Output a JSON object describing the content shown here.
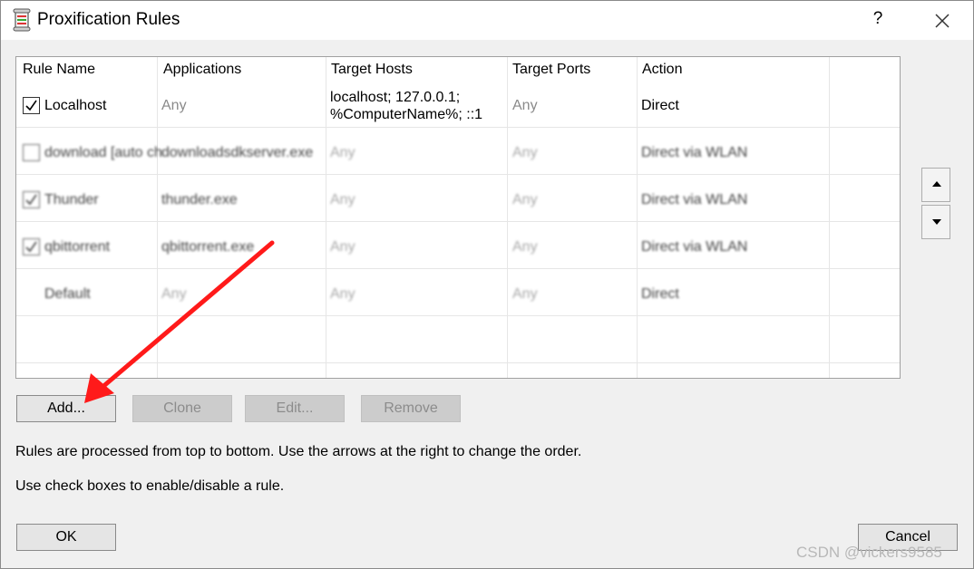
{
  "window": {
    "title": "Proxification Rules",
    "help_label": "?"
  },
  "table": {
    "headers": [
      "Rule Name",
      "Applications",
      "Target Hosts",
      "Target Ports",
      "Action"
    ],
    "rows": [
      {
        "name": "Localhost",
        "checked": true,
        "applications": "Any",
        "hosts_line1": "localhost; 127.0.0.1;",
        "hosts_line2": "%ComputerName%; ::1",
        "ports": "Any",
        "action": "Direct"
      },
      {
        "name": "download [auto ch",
        "checked": false,
        "applications": "downloadsdkserver.exe",
        "hosts": "Any",
        "ports": "Any",
        "action": "Direct via WLAN"
      },
      {
        "name": "Thunder",
        "checked": true,
        "applications": "thunder.exe",
        "hosts": "Any",
        "ports": "Any",
        "action": "Direct via WLAN"
      },
      {
        "name": "qbittorrent",
        "checked": true,
        "applications": "qbittorrent.exe",
        "hosts": "Any",
        "ports": "Any",
        "action": "Direct via WLAN"
      },
      {
        "name": "Default",
        "checked": null,
        "applications": "Any",
        "hosts": "Any",
        "ports": "Any",
        "action": "Direct"
      }
    ]
  },
  "buttons": {
    "add": "Add...",
    "clone": "Clone",
    "edit": "Edit...",
    "remove": "Remove",
    "ok": "OK",
    "cancel": "Cancel"
  },
  "info": {
    "line1": "Rules are processed from top to bottom. Use the arrows at the right to change the order.",
    "line2": "Use check boxes to enable/disable a rule."
  },
  "watermark": "CSDN @vickers9585",
  "colors": {
    "annotation_arrow": "#ff1a1a",
    "muted_text": "#8a8a8a"
  }
}
